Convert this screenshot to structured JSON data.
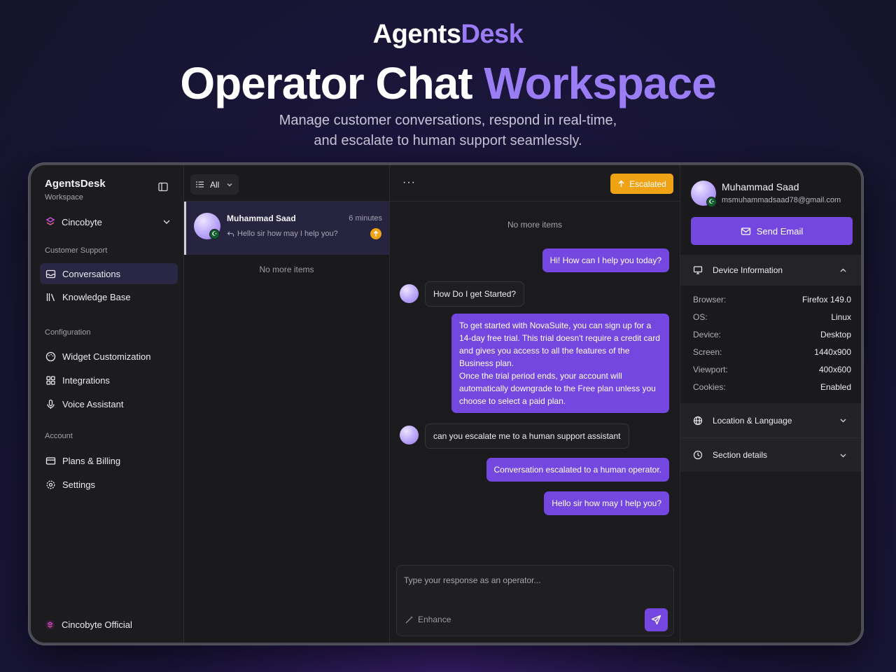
{
  "hero": {
    "brand_prefix": "Agents",
    "brand_suffix": "Desk",
    "headline_main": "Operator Chat ",
    "headline_accent": "Workspace",
    "tagline_line1": "Manage customer conversations, respond in real-time,",
    "tagline_line2": "and escalate to human support seamlessly."
  },
  "sidebar": {
    "app_name": "AgentsDesk",
    "app_sub": "Workspace",
    "org": "Cincobyte",
    "sections": [
      {
        "title": "Customer Support",
        "items": [
          {
            "label": "Conversations",
            "icon": "inbox-icon",
            "active": true
          },
          {
            "label": "Knowledge Base",
            "icon": "library-icon",
            "active": false
          }
        ]
      },
      {
        "title": "Configuration",
        "items": [
          {
            "label": "Widget Customization",
            "icon": "palette-icon",
            "active": false
          },
          {
            "label": "Integrations",
            "icon": "grid-icon",
            "active": false
          },
          {
            "label": "Voice Assistant",
            "icon": "mic-icon",
            "active": false
          }
        ]
      },
      {
        "title": "Account",
        "items": [
          {
            "label": "Plans & Billing",
            "icon": "credit-card-icon",
            "active": false
          },
          {
            "label": "Settings",
            "icon": "gear-icon",
            "active": false
          }
        ]
      }
    ],
    "footer": "Cincobyte Official"
  },
  "convlist": {
    "filter": "All",
    "item": {
      "name": "Muhammad Saad",
      "time": "6 minutes",
      "preview": "Hello sir how may I help you?"
    },
    "empty": "No more items"
  },
  "chat": {
    "menu": "···",
    "escalated_label": "Escalated",
    "empty": "No more items",
    "messages": [
      {
        "from": "operator",
        "text": "Hi! How can I help you today?"
      },
      {
        "from": "user",
        "text": "How Do I get Started?"
      },
      {
        "from": "operator",
        "text": "To get started with NovaSuite, you can sign up for a 14-day free trial. This trial doesn't require a credit card and gives you access to all the features of the Business plan.\nOnce the trial period ends, your account will automatically downgrade to the Free plan unless you choose to select a paid plan."
      },
      {
        "from": "user",
        "text": "can you escalate me to a human support assistant"
      },
      {
        "from": "operator",
        "text": "Conversation escalated to a human operator."
      },
      {
        "from": "operator",
        "text": "Hello sir how may I help you?"
      }
    ],
    "composer_placeholder": "Type your response as an operator...",
    "enhance_label": "Enhance"
  },
  "panel": {
    "name": "Muhammad Saad",
    "email": "msmuhammadsaad78@gmail.com",
    "send_email": "Send Email",
    "device_header": "Device Information",
    "device": [
      {
        "key": "Browser:",
        "value": "Firefox 149.0"
      },
      {
        "key": "OS:",
        "value": "Linux"
      },
      {
        "key": "Device:",
        "value": "Desktop"
      },
      {
        "key": "Screen:",
        "value": "1440x900"
      },
      {
        "key": "Viewport:",
        "value": "400x600"
      },
      {
        "key": "Cookies:",
        "value": "Enabled"
      }
    ],
    "location_header": "Location & Language",
    "section_header": "Section details"
  },
  "colors": {
    "accent": "#7447e0",
    "escalated": "#eea214",
    "active_nav": "#2a2744"
  }
}
